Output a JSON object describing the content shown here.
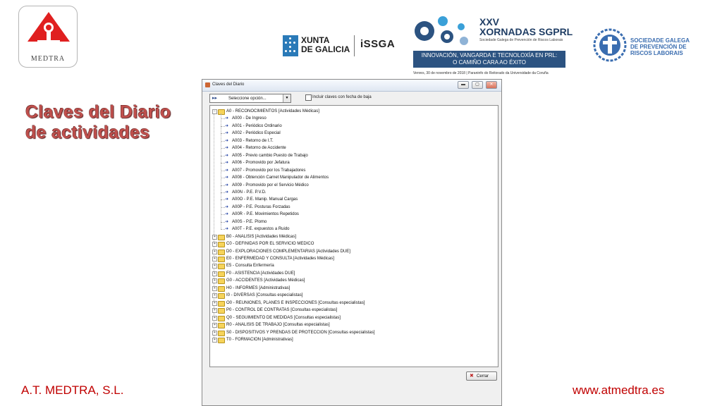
{
  "header": {
    "medtra_logo_text": "MEDTRA",
    "xunta_line1": "XUNTA",
    "xunta_line2": "DE GALICIA",
    "issga": "iSSGA",
    "xornadas_number": "XXV",
    "xornadas_name": "XORNADAS SGPRL",
    "xornadas_org": "Sociedade Galega de Prevención de Riscos Laborais",
    "xornadas_band_1": "INNOVACIÓN, VANGARDA E TECNOLOXÍA EN PRL:",
    "xornadas_band_2": "O CAMIÑO CARA AO ÉXITO",
    "xornadas_date": "Venres, 30 de novembro de 2018 | Paraninfo do Reitorado da Universidade da Coruña",
    "sgprl_line1": "SOCIEDADE GALEGA",
    "sgprl_line2": "DE PREVENCIÓN DE",
    "sgprl_line3": "RISCOS LABORAIS"
  },
  "slide": {
    "title_line1": "Claves del Diario",
    "title_line2": "de actividades"
  },
  "footer": {
    "company": "A.T. MEDTRA, S.L.",
    "website": "www.atmedtra.es"
  },
  "window": {
    "title": "Claves del Diario",
    "select_label": "Seleccione opción...",
    "checkbox_label": "Incluir claves con fecha de baja",
    "checkbox_checked": false,
    "close_button_label": "Cerrar",
    "tree": [
      {
        "label": "A0 - RECONOCIMIENTOS  [Actividades Médicas]",
        "level": 0,
        "expanded": true
      },
      {
        "label": "A000 - De Ingreso",
        "level": 1
      },
      {
        "label": "A001 - Periódico Ordinario",
        "level": 1
      },
      {
        "label": "A002 - Periódico Especial",
        "level": 1
      },
      {
        "label": "A003 - Retorno de I.T.",
        "level": 1
      },
      {
        "label": "A004 - Retorno de Accidente",
        "level": 1
      },
      {
        "label": "A005 - Previo cambio Puesto de Trabajo",
        "level": 1
      },
      {
        "label": "A006 - Promovido por Jefatura",
        "level": 1
      },
      {
        "label": "A007 - Promovido por los Trabajadores",
        "level": 1
      },
      {
        "label": "A008 - Obtención Carnet Manipulador de Alimentos",
        "level": 1
      },
      {
        "label": "A009 - Promovido por el Servicio Médico",
        "level": 1
      },
      {
        "label": "A00N - P.E. P.V.D.",
        "level": 1
      },
      {
        "label": "A00O - P.E. Manip. Manual Cargas",
        "level": 1
      },
      {
        "label": "A00P - P.E. Posturas Forzadas",
        "level": 1
      },
      {
        "label": "A00R - P.E. Movimientos Repetidos",
        "level": 1
      },
      {
        "label": "A00S - P.E. Plomo",
        "level": 1
      },
      {
        "label": "A00T - P.E. expuestos a Ruido",
        "level": 1
      },
      {
        "label": "B0 - ANALISIS  [Actividades Médicas]",
        "level": 0,
        "expanded": false
      },
      {
        "label": "C0 - DEFINIDAS POR EL SERVICIO MEDICO",
        "level": 0,
        "expanded": false
      },
      {
        "label": "D0 - EXPLORACIONES COMPLEMENTARIAS  [Actividades DUE]",
        "level": 0,
        "expanded": false
      },
      {
        "label": "E0 - ENFERMEDAD Y CONSULTA  [Actividades Médicas]",
        "level": 0,
        "expanded": false
      },
      {
        "label": "E5 - Consulta Enfermería",
        "level": 0,
        "expanded": false
      },
      {
        "label": "F0 - ASISTENCIA  [Actividades DUE]",
        "level": 0,
        "expanded": false
      },
      {
        "label": "G0 - ACCIDENTES  [Actividades Médicas]",
        "level": 0,
        "expanded": false
      },
      {
        "label": "H0 - INFORMES  [Administrativas]",
        "level": 0,
        "expanded": false
      },
      {
        "label": "I0 - DIVERSAS  [Consultas especialistas]",
        "level": 0,
        "expanded": false
      },
      {
        "label": "O0 - REUNIONES, PLANES E INSPECCIONES  [Consultas especialistas]",
        "level": 0,
        "expanded": false
      },
      {
        "label": "P0 - CONTROL DE CONTRATAS  [Consultas especialistas]",
        "level": 0,
        "expanded": false
      },
      {
        "label": "Q0 - SEGUIMIENTO DE MEDIDAS  [Consultas especialistas]",
        "level": 0,
        "expanded": false
      },
      {
        "label": "R0 - ANALISIS DE TRABAJO  [Consultas especialistas]",
        "level": 0,
        "expanded": false
      },
      {
        "label": "S0 - DISPOSITIVOS Y PRENDAS DE PROTECCION  [Consultas especialistas]",
        "level": 0,
        "expanded": false
      },
      {
        "label": "T0 - FORMACION  [Administrativas]",
        "level": 0,
        "expanded": false
      }
    ]
  },
  "colors": {
    "title": "#c0504d",
    "footer": "#c00000",
    "folder": "#f6d35a",
    "band": "#2c5381"
  }
}
